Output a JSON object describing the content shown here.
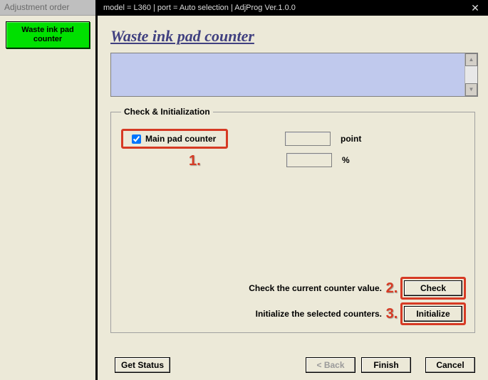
{
  "left": {
    "header": "Adjustment order",
    "btn": "Waste ink pad counter"
  },
  "titlebar": "model = L360 | port = Auto selection | AdjProg Ver.1.0.0",
  "page_title": "Waste ink pad counter",
  "fieldset_legend": "Check & Initialization",
  "main_pad_label": "Main pad counter",
  "points": {
    "value": "",
    "unit": "point"
  },
  "percent": {
    "value": "",
    "unit": "%"
  },
  "instr_check": "Check the current counter value.",
  "instr_init": "Initialize the selected counters.",
  "buttons": {
    "check": "Check",
    "initialize": "Initialize",
    "get_status": "Get Status",
    "back": "< Back",
    "finish": "Finish",
    "cancel": "Cancel"
  },
  "annotations": {
    "a1": "1.",
    "a2": "2.",
    "a3": "3."
  }
}
